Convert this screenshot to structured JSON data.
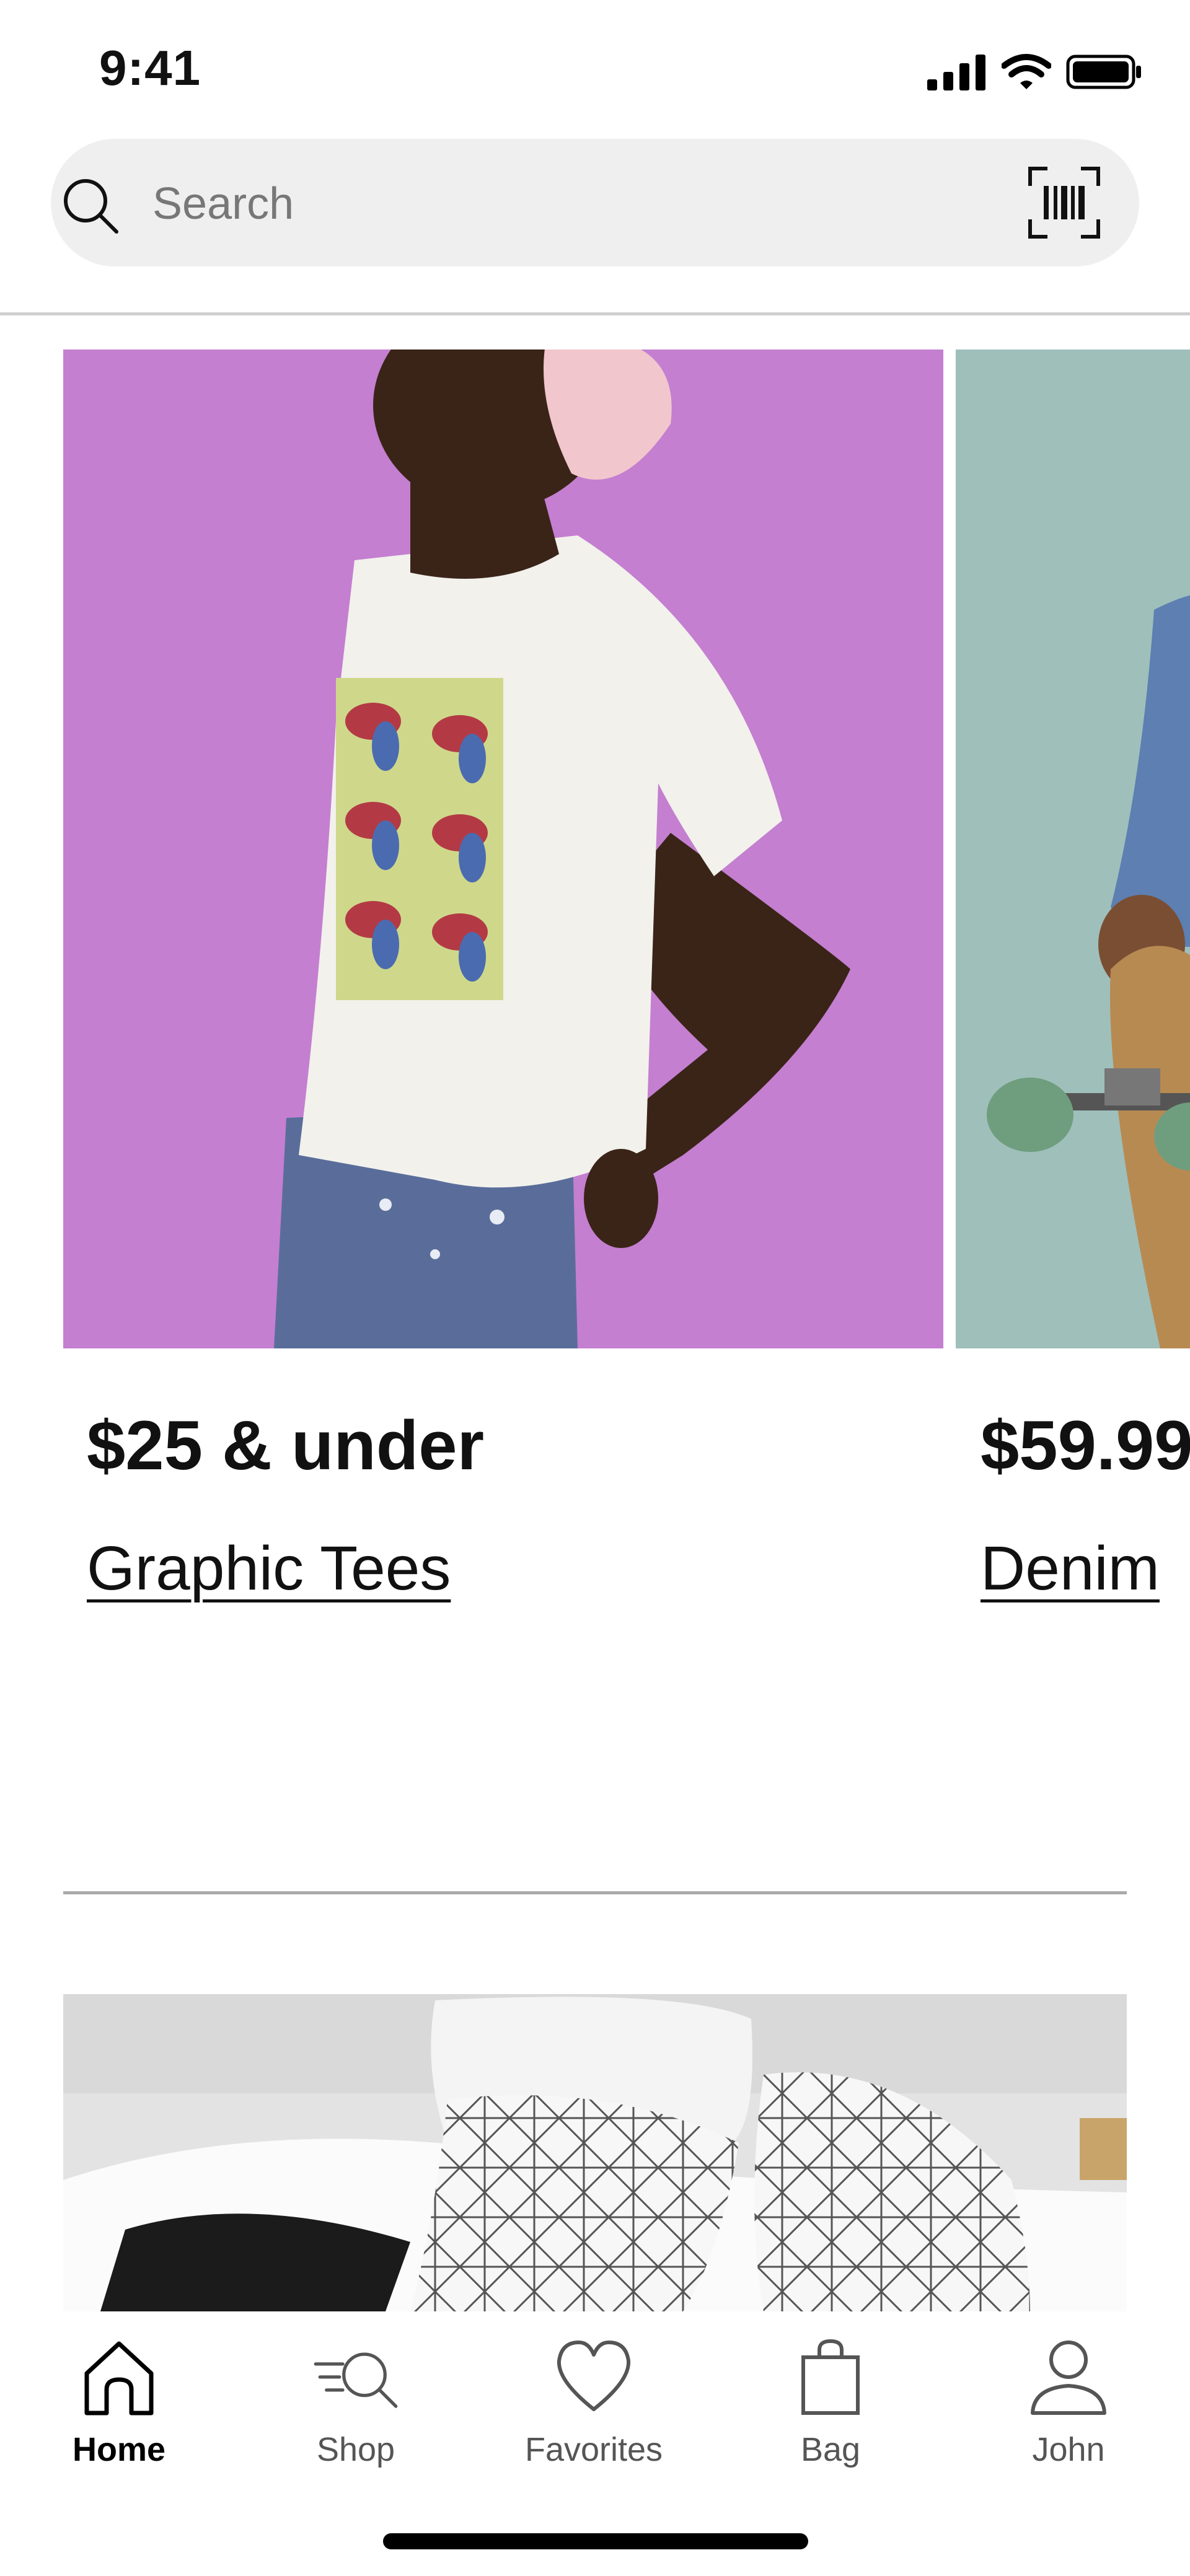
{
  "status_bar": {
    "time": "9:41"
  },
  "search": {
    "placeholder": "Search"
  },
  "carousel": [
    {
      "price_label": "$25 & under",
      "link_label": "Graphic Tees"
    },
    {
      "price_label": "$59.99",
      "link_label": "Denim"
    }
  ],
  "tabs": [
    {
      "label": "Home",
      "icon": "home-icon",
      "active": true
    },
    {
      "label": "Shop",
      "icon": "shop-search-icon",
      "active": false
    },
    {
      "label": "Favorites",
      "icon": "heart-icon",
      "active": false
    },
    {
      "label": "Bag",
      "icon": "bag-icon",
      "active": false
    },
    {
      "label": "John",
      "icon": "person-icon",
      "active": false
    }
  ],
  "colors": {
    "card1_background": "#c47fd0",
    "card2_background": "#9fbfbb",
    "search_background": "#efefef"
  }
}
